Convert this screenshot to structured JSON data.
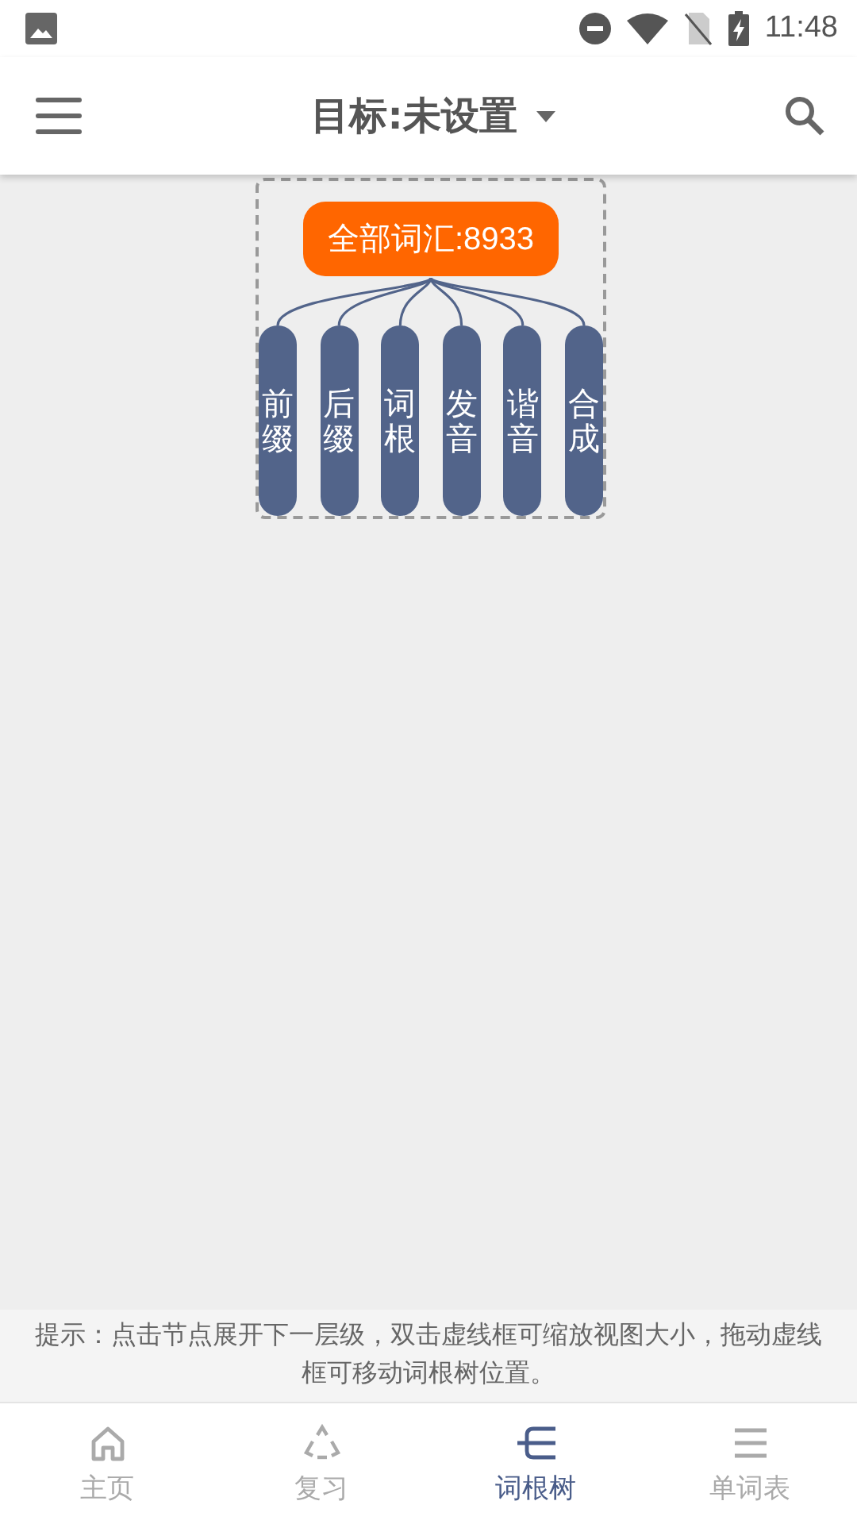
{
  "status_bar": {
    "time": "11:48"
  },
  "app_bar": {
    "title": "目标:未设置"
  },
  "tree": {
    "root": "全部词汇:8933",
    "children": [
      {
        "label": "前缀"
      },
      {
        "label": "后缀"
      },
      {
        "label": "词根"
      },
      {
        "label": "发音"
      },
      {
        "label": "谐音"
      },
      {
        "label": "合成"
      }
    ]
  },
  "hint": "提示：点击节点展开下一层级，双击虚线框可缩放视图大小，拖动虚线框可移动词根树位置。",
  "bottom_nav": [
    {
      "kind": "home",
      "label": "主页",
      "selected": false
    },
    {
      "kind": "review",
      "label": "复习",
      "selected": false
    },
    {
      "kind": "tree",
      "label": "词根树",
      "selected": true
    },
    {
      "kind": "list",
      "label": "单词表",
      "selected": false
    }
  ]
}
